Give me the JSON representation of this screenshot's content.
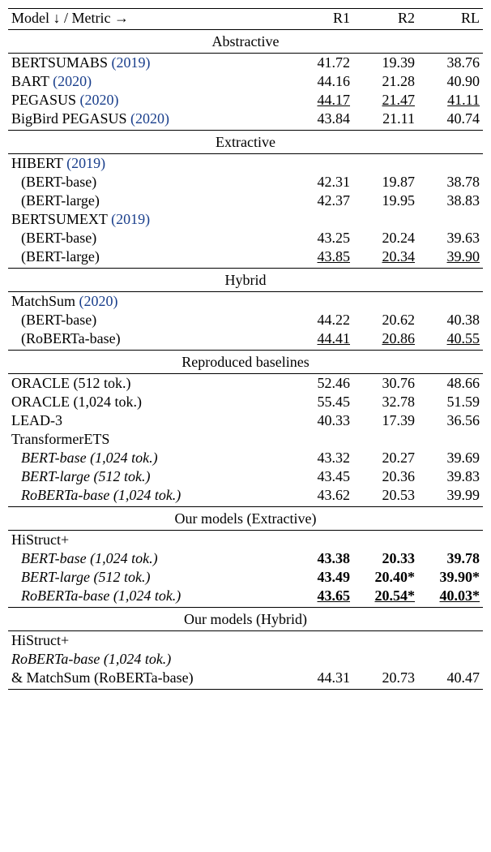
{
  "header": {
    "model": "Model ↓ / Metric →",
    "r1": "R1",
    "r2": "R2",
    "rl": "RL"
  },
  "sec_abstractive": "Abstractive",
  "bertsumabs": {
    "name": "BERTSUMABS",
    "cite": "(2019)",
    "r1": "41.72",
    "r2": "19.39",
    "rl": "38.76"
  },
  "bart": {
    "name": "BART",
    "cite": "(2020)",
    "r1": "44.16",
    "r2": "21.28",
    "rl": "40.90"
  },
  "pegasus": {
    "name": "PEGASUS",
    "cite": "(2020)",
    "r1": "44.17",
    "r2": "21.47",
    "rl": "41.11"
  },
  "bigbird": {
    "name": "BigBird PEGASUS",
    "cite": "(2020)",
    "r1": "43.84",
    "r2": "21.11",
    "rl": "40.74"
  },
  "sec_extractive": "Extractive",
  "hibert": {
    "name": "HIBERT",
    "cite": "(2019)"
  },
  "hibert_base": {
    "name": "(BERT-base)",
    "r1": "42.31",
    "r2": "19.87",
    "rl": "38.78"
  },
  "hibert_large": {
    "name": "(BERT-large)",
    "r1": "42.37",
    "r2": "19.95",
    "rl": "38.83"
  },
  "bertsumext": {
    "name": "BERTSUMEXT",
    "cite": "(2019)"
  },
  "bse_base": {
    "name": "(BERT-base)",
    "r1": "43.25",
    "r2": "20.24",
    "rl": "39.63"
  },
  "bse_large": {
    "name": "(BERT-large)",
    "r1": "43.85",
    "r2": "20.34",
    "rl": "39.90"
  },
  "sec_hybrid": "Hybrid",
  "matchsum": {
    "name": "MatchSum",
    "cite": "(2020)"
  },
  "ms_bert": {
    "name": "(BERT-base)",
    "r1": "44.22",
    "r2": "20.62",
    "rl": "40.38"
  },
  "ms_rob": {
    "name": "(RoBERTa-base)",
    "r1": "44.41",
    "r2": "20.86",
    "rl": "40.55"
  },
  "sec_repro": "Reproduced baselines",
  "oracle512": {
    "name": "ORACLE (512 tok.)",
    "r1": "52.46",
    "r2": "30.76",
    "rl": "48.66"
  },
  "oracle1024": {
    "name": "ORACLE (1,024 tok.)",
    "r1": "55.45",
    "r2": "32.78",
    "rl": "51.59"
  },
  "lead3": {
    "name": "LEAD-3",
    "r1": "40.33",
    "r2": "17.39",
    "rl": "36.56"
  },
  "tets": {
    "name": "TransformerETS"
  },
  "tets_bb": {
    "name": "BERT-base (1,024 tok.)",
    "r1": "43.32",
    "r2": "20.27",
    "rl": "39.69"
  },
  "tets_bl": {
    "name": "BERT-large (512 tok.)",
    "r1": "43.45",
    "r2": "20.36",
    "rl": "39.83"
  },
  "tets_rb": {
    "name": "RoBERTa-base (1,024 tok.)",
    "r1": "43.62",
    "r2": "20.53",
    "rl": "39.99"
  },
  "sec_our_ext": "Our models (Extractive)",
  "histruct": {
    "name": "HiStruct+"
  },
  "hs_bb": {
    "name": "BERT-base (1,024 tok.)",
    "r1": "43.38",
    "r2": "20.33",
    "rl": "39.78"
  },
  "hs_bl": {
    "name": "BERT-large (512 tok.)",
    "r1": "43.49",
    "r2": "20.40*",
    "rl": "39.90*"
  },
  "hs_rb": {
    "name": "RoBERTa-base (1,024 tok.)",
    "r1": "43.65",
    "r2": "20.54*",
    "rl": "40.03*"
  },
  "sec_our_hyb": "Our models (Hybrid)",
  "hs_hyb1": {
    "name": "HiStruct+"
  },
  "hs_hyb2": {
    "name": "RoBERTa-base (1,024 tok.)"
  },
  "hs_hyb3": {
    "name": "& MatchSum (RoBERTa-base)",
    "r1": "44.31",
    "r2": "20.73",
    "rl": "40.47"
  },
  "chart_data": {
    "type": "table",
    "columns": [
      "Model",
      "R1",
      "R2",
      "RL"
    ],
    "sections": [
      {
        "name": "Abstractive",
        "rows": [
          {
            "model": "BERTSUMABS (2019)",
            "R1": 41.72,
            "R2": 19.39,
            "RL": 38.76
          },
          {
            "model": "BART (2020)",
            "R1": 44.16,
            "R2": 21.28,
            "RL": 40.9
          },
          {
            "model": "PEGASUS (2020)",
            "R1": 44.17,
            "R2": 21.47,
            "RL": 41.11,
            "best_in_section": true
          },
          {
            "model": "BigBird PEGASUS (2020)",
            "R1": 43.84,
            "R2": 21.11,
            "RL": 40.74
          }
        ]
      },
      {
        "name": "Extractive",
        "rows": [
          {
            "model": "HIBERT (2019) (BERT-base)",
            "R1": 42.31,
            "R2": 19.87,
            "RL": 38.78
          },
          {
            "model": "HIBERT (2019) (BERT-large)",
            "R1": 42.37,
            "R2": 19.95,
            "RL": 38.83
          },
          {
            "model": "BERTSUMEXT (2019) (BERT-base)",
            "R1": 43.25,
            "R2": 20.24,
            "RL": 39.63
          },
          {
            "model": "BERTSUMEXT (2019) (BERT-large)",
            "R1": 43.85,
            "R2": 20.34,
            "RL": 39.9,
            "best_in_section": true
          }
        ]
      },
      {
        "name": "Hybrid",
        "rows": [
          {
            "model": "MatchSum (2020) (BERT-base)",
            "R1": 44.22,
            "R2": 20.62,
            "RL": 40.38
          },
          {
            "model": "MatchSum (2020) (RoBERTa-base)",
            "R1": 44.41,
            "R2": 20.86,
            "RL": 40.55,
            "best_in_section": true
          }
        ]
      },
      {
        "name": "Reproduced baselines",
        "rows": [
          {
            "model": "ORACLE (512 tok.)",
            "R1": 52.46,
            "R2": 30.76,
            "RL": 48.66
          },
          {
            "model": "ORACLE (1,024 tok.)",
            "R1": 55.45,
            "R2": 32.78,
            "RL": 51.59
          },
          {
            "model": "LEAD-3",
            "R1": 40.33,
            "R2": 17.39,
            "RL": 36.56
          },
          {
            "model": "TransformerETS BERT-base (1,024 tok.)",
            "R1": 43.32,
            "R2": 20.27,
            "RL": 39.69
          },
          {
            "model": "TransformerETS BERT-large (512 tok.)",
            "R1": 43.45,
            "R2": 20.36,
            "RL": 39.83
          },
          {
            "model": "TransformerETS RoBERTa-base (1,024 tok.)",
            "R1": 43.62,
            "R2": 20.53,
            "RL": 39.99
          }
        ]
      },
      {
        "name": "Our models (Extractive)",
        "rows": [
          {
            "model": "HiStruct+ BERT-base (1,024 tok.)",
            "R1": 43.38,
            "R2": 20.33,
            "RL": 39.78,
            "bold": true
          },
          {
            "model": "HiStruct+ BERT-large (512 tok.)",
            "R1": 43.49,
            "R2": 20.4,
            "RL": 39.9,
            "bold": true,
            "star": [
              "R2",
              "RL"
            ]
          },
          {
            "model": "HiStruct+ RoBERTa-base (1,024 tok.)",
            "R1": 43.65,
            "R2": 20.54,
            "RL": 40.03,
            "bold": true,
            "underline": true,
            "star": [
              "R2",
              "RL"
            ]
          }
        ]
      },
      {
        "name": "Our models (Hybrid)",
        "rows": [
          {
            "model": "HiStruct+ RoBERTa-base (1,024 tok.) & MatchSum (RoBERTa-base)",
            "R1": 44.31,
            "R2": 20.73,
            "RL": 40.47
          }
        ]
      }
    ]
  }
}
